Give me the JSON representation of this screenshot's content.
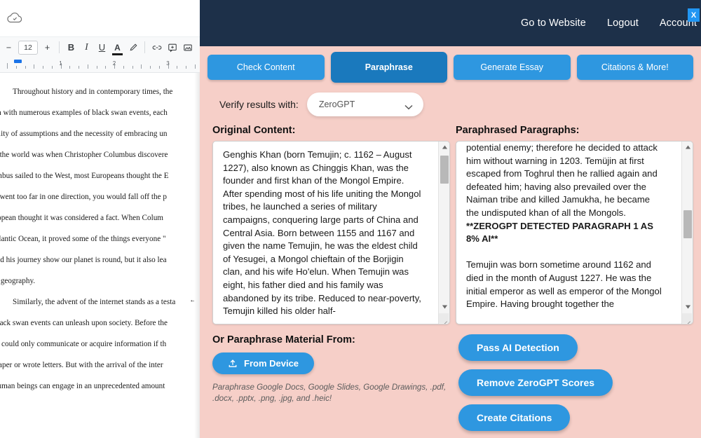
{
  "doc_editor": {
    "cloud_icon": "cloud-saved-icon",
    "toolbar": {
      "decrease_label": "−",
      "font_size": "12",
      "increase_label": "+",
      "bold_label": "B",
      "italic_label": "I",
      "underline_label": "U",
      "text_color_label": "A",
      "highlight_icon": "pen-highlight-icon",
      "link_icon": "link-icon",
      "comment_icon": "add-comment-icon",
      "image_icon": "insert-image-icon"
    },
    "ruler": {
      "marks": [
        "1",
        "2",
        "3"
      ]
    },
    "document_lines": [
      "Throughout history and in contemporary times, the",
      "oven with numerous examples of black swan events, each",
      "llibility of assumptions and the necessity of embracing un",
      "ook the world was when Christopher Columbus discovere",
      "olumbus sailed to the West, most Europeans thought the E",
      "you went too far in one direction, you would fall off the p",
      "European thought it was considered a fact. When Colum",
      "e Atlantic Ocean, it proved some of the things everyone \"",
      "ly did his journey show our planet is round, but it also lea",
      "orld geography.",
      "Similarly, the advent of the internet stands as a testa",
      "at black swan events can unleash upon society. Before the",
      "ople could only communicate or acquire information if th",
      "wspaper or wrote letters. But with the arrival of the inter",
      "w human beings can engage in an unprecedented amount"
    ],
    "arrow_marker": "↔"
  },
  "app": {
    "header": {
      "nav": [
        {
          "label": "Go to Website"
        },
        {
          "label": "Logout"
        },
        {
          "label": "Account"
        }
      ],
      "close_label": "X"
    },
    "tabs": [
      {
        "label": "Check Content",
        "active": false
      },
      {
        "label": "Paraphrase",
        "active": true
      },
      {
        "label": "Generate Essay",
        "active": false
      },
      {
        "label": "Citations & More!",
        "active": false
      }
    ],
    "verify": {
      "label": "Verify results with:",
      "selected": "ZeroGPT",
      "chevron_icon": "chevron-down-icon"
    },
    "original": {
      "title": "Original Content:",
      "text": "Genghis Khan (born Temujin; c. 1162 – August 1227), also known as Chinggis Khan, was the founder and first khan of the Mongol Empire. After spending most of his life uniting the Mongol tribes, he launched a series of military campaigns, conquering large parts of China and Central Asia. Born between 1155 and 1167 and given the name Temujin, he was the eldest child of Yesugei, a Mongol chieftain of the Borjigin clan, and his wife Ho'elun. When Temujin was eight, his father died and his family was abandoned by its tribe. Reduced to near-poverty, Temujin killed his older half-"
    },
    "paraphrased": {
      "title": "Paraphrased Paragraphs:",
      "para_1": "potential enemy; therefore he decided to attack him without warning in 1203. Temüjin at first escaped from Toghrul then he rallied again and defeated him; having also prevailed over the Naiman tribe and killed Jamukha, he became the undisputed khan of all the Mongols.",
      "detection_note": "**ZEROGPT DETECTED PARAGRAPH 1 AS 8% AI**",
      "para_2": "Temujin was born sometime around 1162 and died in the month of August 1227. He was the initial emperor as well as emperor of the Mongol Empire. Having brought together the"
    },
    "upload": {
      "title": "Or Paraphrase Material From:",
      "button_label": "From Device",
      "upload_icon": "upload-icon",
      "note": "Paraphrase Google Docs, Google Slides, Google Drawings, .pdf, .docx, .pptx, .png, .jpg, and .heic!"
    },
    "actions": [
      {
        "label": "Pass AI Detection"
      },
      {
        "label": "Remove ZeroGPT Scores"
      },
      {
        "label": "Create Citations"
      }
    ],
    "colors": {
      "header_bg": "#1d3049",
      "panel_bg": "#f6cfc8",
      "tab_blue": "#2e97e0",
      "tab_active_blue": "#1a79bd",
      "close_blue": "#2196f3"
    }
  }
}
